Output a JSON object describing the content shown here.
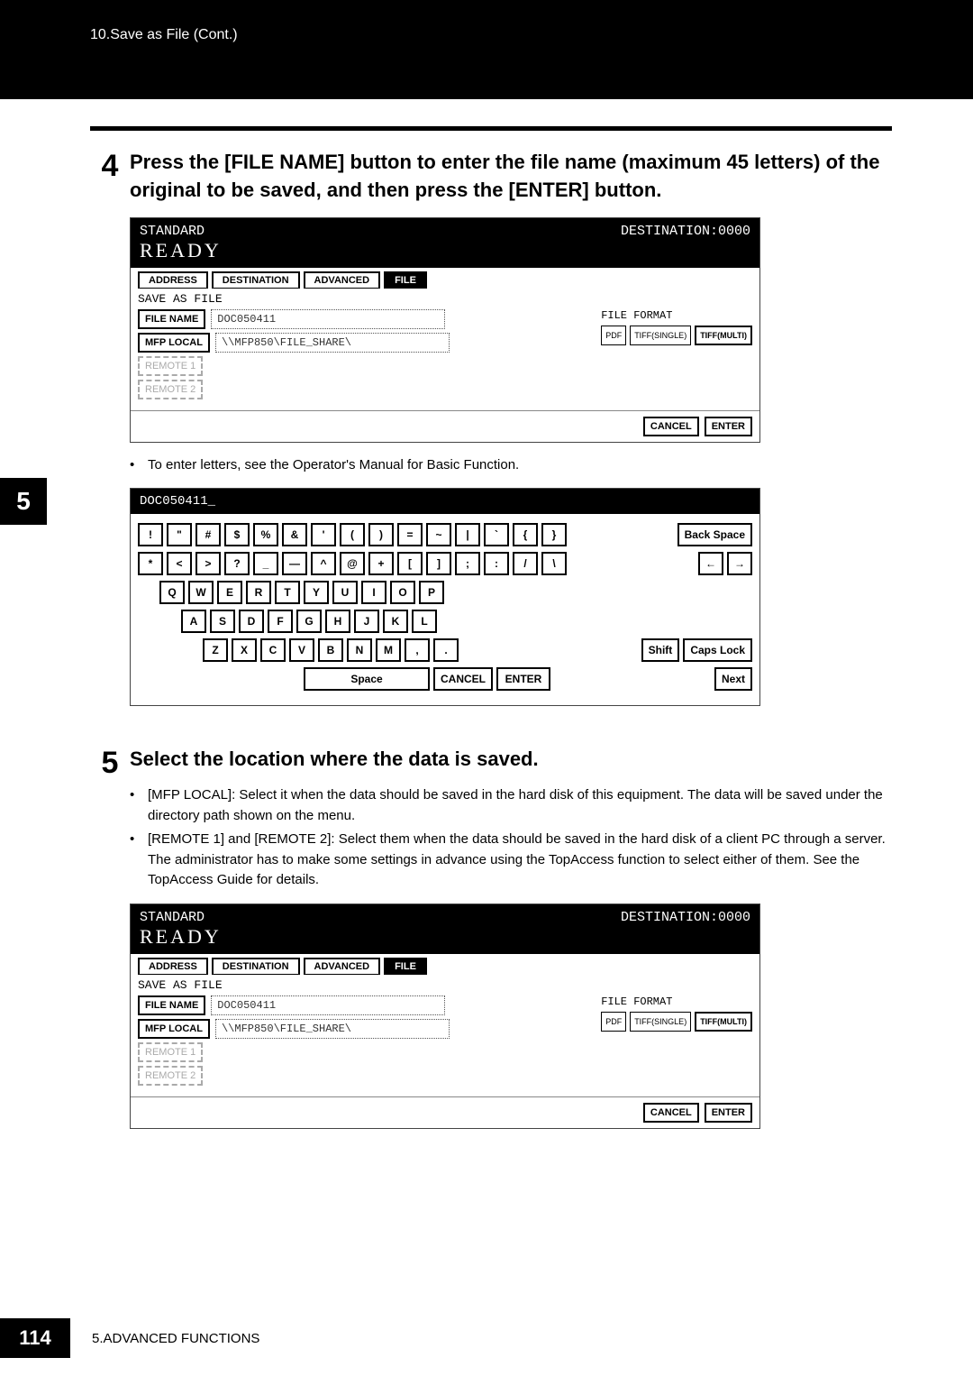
{
  "header": {
    "breadcrumb": "10.Save as File (Cont.)"
  },
  "side_tab": "5",
  "step4": {
    "num": "4",
    "title": "Press the [FILE NAME] button to enter the file name (maximum 45 letters) of the original to be saved, and then press the [ENTER] button.",
    "note": "To enter letters, see the Operator's Manual for Basic Function."
  },
  "step5": {
    "num": "5",
    "title": "Select the location where the data is saved.",
    "bullets": [
      "[MFP LOCAL]: Select it when the data should be saved in the hard disk of this equipment. The data will be saved under the directory path shown on the menu.",
      "[REMOTE 1] and [REMOTE 2]: Select them when the data should be saved in the hard disk of a client PC through a server. The administrator has to make some settings in advance using the TopAccess function to select either of them. See the TopAccess Guide for details."
    ]
  },
  "mfp": {
    "mode": "STANDARD",
    "destination_label": "DESTINATION:0000",
    "ready": "READY",
    "tabs": {
      "address": "ADDRESS",
      "destination": "DESTINATION",
      "advanced": "ADVANCED",
      "file": "FILE"
    },
    "save_as_file_label": "SAVE AS FILE",
    "file_name_btn": "FILE NAME",
    "file_name_value": "DOC050411",
    "mfp_local_btn": "MFP LOCAL",
    "mfp_local_path": "\\\\MFP850\\FILE_SHARE\\",
    "remote1": "REMOTE 1",
    "remote2": "REMOTE 2",
    "file_format_label": "FILE FORMAT",
    "formats": {
      "pdf": "PDF",
      "tiff_single": "TIFF(SINGLE)",
      "tiff_multi": "TIFF(MULTI)"
    },
    "cancel": "CANCEL",
    "enter": "ENTER"
  },
  "keyboard": {
    "entered": "DOC050411_",
    "row1": [
      "!",
      "\"",
      "#",
      "$",
      "%",
      "&",
      "'",
      "(",
      ")",
      "=",
      "~",
      "|",
      "`",
      "{",
      "}"
    ],
    "row2": [
      "*",
      "<",
      ">",
      "?",
      "_",
      "—",
      "^",
      "@",
      "+",
      "[",
      "]",
      ";",
      ":",
      "/",
      "\\"
    ],
    "row3": [
      "Q",
      "W",
      "E",
      "R",
      "T",
      "Y",
      "U",
      "I",
      "O",
      "P"
    ],
    "row4": [
      "A",
      "S",
      "D",
      "F",
      "G",
      "H",
      "J",
      "K",
      "L"
    ],
    "row5": [
      "Z",
      "X",
      "C",
      "V",
      "B",
      "N",
      "M",
      ",",
      "."
    ],
    "backspace": "Back Space",
    "left": "←",
    "right": "→",
    "shift": "Shift",
    "capslock": "Caps Lock",
    "space": "Space",
    "cancel": "CANCEL",
    "enter": "ENTER",
    "next": "Next"
  },
  "footer": {
    "page": "114",
    "section": "5.ADVANCED FUNCTIONS"
  }
}
